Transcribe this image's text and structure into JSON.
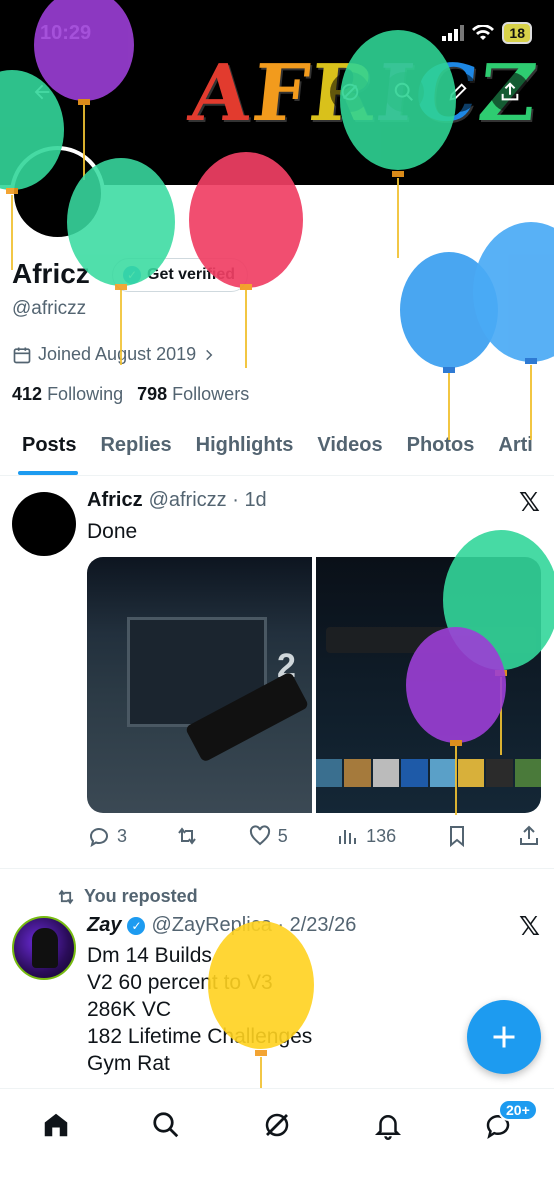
{
  "status": {
    "time": "10:29",
    "battery": "18"
  },
  "banner": {
    "title_letters": [
      "A",
      "F",
      "R",
      "I",
      "C",
      "Z"
    ],
    "letter_colors": [
      "#e23b2e",
      "#f29b1d",
      "#f4d41b",
      "#8e44ad",
      "#1e88e5",
      "#2ecc71"
    ]
  },
  "profile": {
    "name": "Africz",
    "verify_label": "Get verified",
    "handle": "@africzz",
    "joined": "Joined August 2019",
    "following_count": "412",
    "following_label": "Following",
    "followers_count": "798",
    "followers_label": "Followers"
  },
  "tabs": [
    "Posts",
    "Replies",
    "Highlights",
    "Videos",
    "Photos",
    "Arti"
  ],
  "tweet1": {
    "name": "Africz",
    "handle_time": "@africzz · 1d",
    "text": "Done",
    "replies": "3",
    "likes": "5",
    "views": "136"
  },
  "tweet2": {
    "repost_label": "You reposted",
    "name": "Zay",
    "handle_time": "@ZayReplica · 2/23/26",
    "text": "Dm 14 Builds\nV2 60 percent to V3\n286K VC\n182 Lifetime Challenges\nGym Rat"
  },
  "nav": {
    "badge": "20+"
  },
  "colors": {
    "accent": "#1d9bf0",
    "text": "#0f1419",
    "muted": "#536471"
  },
  "icons": [
    "back-arrow-icon",
    "grok-icon",
    "search-icon",
    "edit-icon",
    "share-icon",
    "calendar-icon",
    "chevron-right-icon",
    "x-logo-icon",
    "reply-icon",
    "repost-icon",
    "like-icon",
    "views-icon",
    "bookmark-icon",
    "home-icon",
    "explore-icon",
    "grok-nav-icon",
    "notifications-icon",
    "messages-icon",
    "plus-icon"
  ]
}
